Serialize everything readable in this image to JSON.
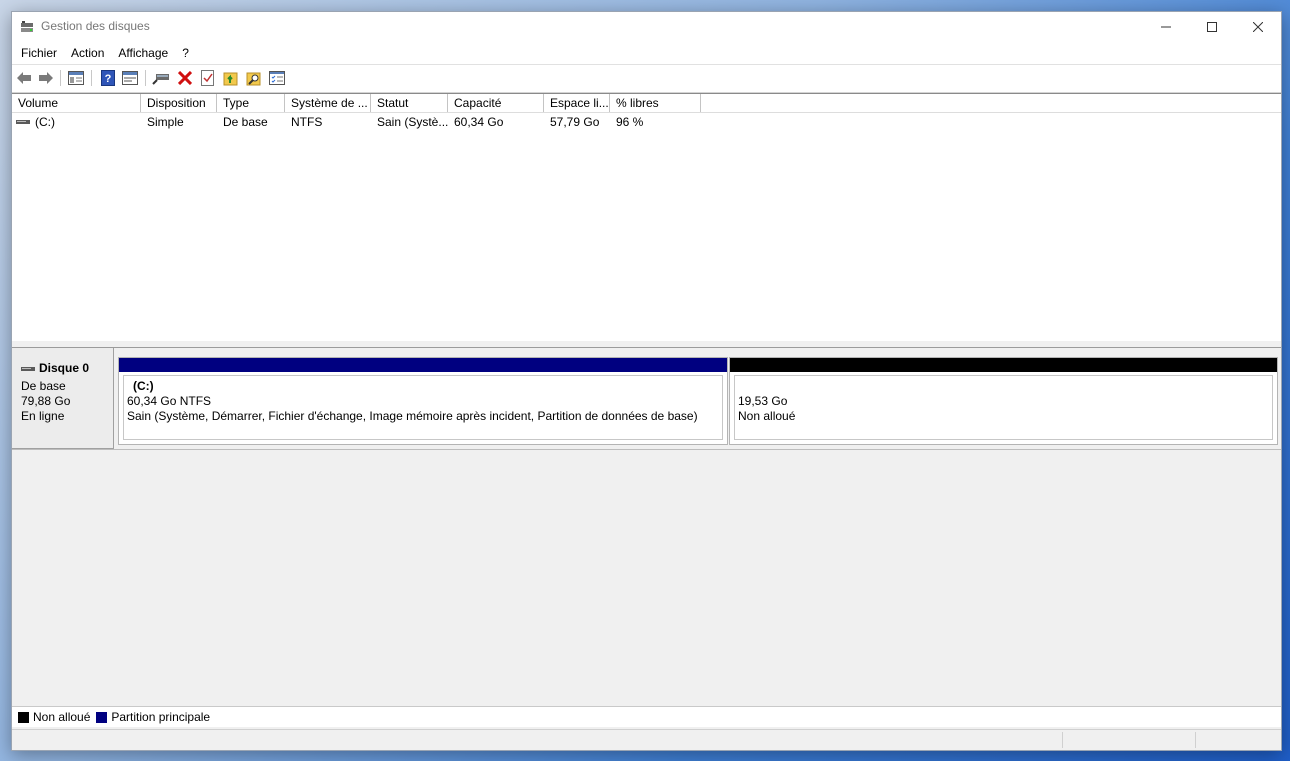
{
  "window": {
    "title": "Gestion des disques"
  },
  "menu": [
    "Fichier",
    "Action",
    "Affichage",
    "?"
  ],
  "toolbar": {
    "icons": [
      "back-arrow-icon",
      "forward-arrow-icon",
      "console-tree-icon",
      "help-icon",
      "properties-icon",
      "connect-icon",
      "delete-icon",
      "check-icon",
      "open-folder-icon",
      "explore-icon",
      "view-list-icon"
    ]
  },
  "volume_list": {
    "columns": [
      "Volume",
      "Disposition",
      "Type",
      "Système de ...",
      "Statut",
      "Capacité",
      "Espace li...",
      "% libres"
    ],
    "rows": [
      {
        "volume": "(C:)",
        "disposition": "Simple",
        "type": "De base",
        "fs": "NTFS",
        "status": "Sain (Systè...",
        "capacity": "60,34 Go",
        "free": "57,79 Go",
        "pct_free": "96 %"
      }
    ]
  },
  "disk": {
    "name": "Disque 0",
    "kind": "De base",
    "size": "79,88 Go",
    "state": "En ligne",
    "partitions": [
      {
        "label": "(C:)",
        "size_fs": "60,34 Go NTFS",
        "status": "Sain (Système, Démarrer, Fichier d'échange, Image mémoire après incident, Partition de données de base)",
        "color": "#000080"
      },
      {
        "label": "",
        "size_fs": "19,53 Go",
        "status": "Non alloué",
        "color": "#000000"
      }
    ]
  },
  "legend": [
    {
      "label": "Non alloué",
      "color": "#000000"
    },
    {
      "label": "Partition principale",
      "color": "#000080"
    }
  ]
}
